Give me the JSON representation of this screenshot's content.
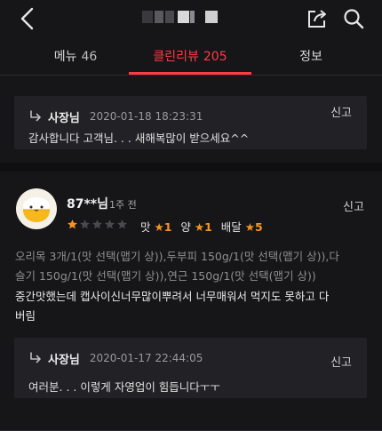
{
  "header": {
    "back_icon": "chevron-left-icon",
    "share_icon": "share-icon",
    "search_icon": "search-icon",
    "title_colors": [
      "#3a3a3e",
      "#5a5a5e",
      "#4a4a4e",
      "#d8d8d8",
      "#8a8a8e",
      "#cfcfcf"
    ]
  },
  "tabs": [
    {
      "label": "메뉴",
      "count": "46"
    },
    {
      "label": "클린리뷰",
      "count": "205"
    },
    {
      "label": "정보",
      "count": ""
    }
  ],
  "accent_color": "#ff3b43",
  "star_color": "#f7941d",
  "reply1": {
    "author": "사장님",
    "timestamp": "2020-01-18 18:23:31",
    "report": "신고",
    "text": "감사합니다 고객님. . . 새해복많이 받으세요^^"
  },
  "review": {
    "avatar_icon": "rice-bowl-avatar-icon",
    "user": "87**님",
    "ago": "1주 전",
    "report": "신고",
    "star_rating": 1,
    "star_max": 5,
    "taste_label": "맛",
    "taste_value": "★1",
    "amount_label": "양",
    "amount_value": "★1",
    "delivery_label": "배달",
    "delivery_value": "★5",
    "order_lines": [
      "오리목 3개/1(맛 선택(맵기 상)),두부피 150g/1(맛 선택(맵기 상)),다",
      "슬기 150g/1(맛 선택(맵기 상)),연근 150g/1(맛 선택(맵기 상))"
    ],
    "body_lines": [
      "중간맛했는데 캡사이신너무많이뿌려서 너무매워서 먹지도 못하고 다",
      "버림"
    ]
  },
  "reply2": {
    "author": "사장님",
    "timestamp": "2020-01-17 22:44:05",
    "report": "신고",
    "text": "여러분. . . 이렇게 자영업이 힘듭니다ㅜㅜ"
  }
}
